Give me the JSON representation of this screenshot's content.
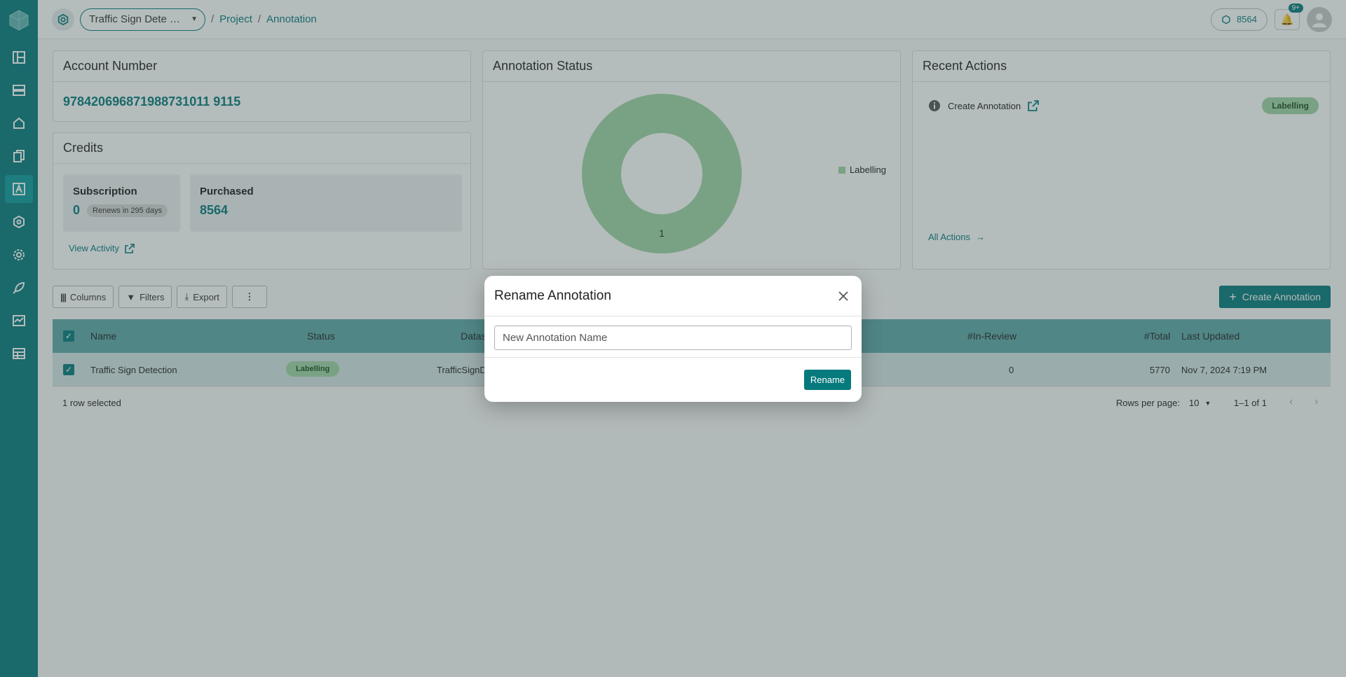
{
  "header": {
    "project_name": "Traffic Sign Dete …",
    "breadcrumb_sep": "/",
    "breadcrumb": [
      "Project",
      "Annotation"
    ],
    "credits_count": "8564",
    "notification_badge": "9+"
  },
  "account": {
    "title": "Account Number",
    "number": "978420696871988731011 9115"
  },
  "credits": {
    "title": "Credits",
    "subscription_label": "Subscription",
    "subscription_value": "0",
    "renew_text": "Renews in 295 days",
    "purchased_label": "Purchased",
    "purchased_value": "8564",
    "view_activity": "View Activity"
  },
  "annotation_status": {
    "title": "Annotation Status",
    "legend": "Labelling",
    "slice_value": "1"
  },
  "chart_data": {
    "type": "pie",
    "categories": [
      "Labelling"
    ],
    "values": [
      1
    ],
    "title": "Annotation Status",
    "legend_position": "right"
  },
  "recent_actions": {
    "title": "Recent Actions",
    "item_label": "Create Annotation",
    "item_status": "Labelling",
    "all_actions": "All Actions"
  },
  "toolbar": {
    "columns": "Columns",
    "filters": "Filters",
    "export": "Export",
    "create": "Create Annotation"
  },
  "table": {
    "headers": {
      "name": "Name",
      "status": "Status",
      "dataset": "Datase",
      "in_review": "#In-Review",
      "total": "#Total",
      "last_updated": "Last Updated"
    },
    "row": {
      "name": "Traffic Sign Detection",
      "status": "Labelling",
      "dataset": "TrafficSignD",
      "in_review": "0",
      "total": "5770",
      "last_updated": "Nov 7, 2024 7:19 PM"
    }
  },
  "footer": {
    "selected": "1 row selected",
    "rows_per_page_label": "Rows per page:",
    "rows_per_page": "10",
    "range": "1–1 of 1"
  },
  "modal": {
    "title": "Rename Annotation",
    "placeholder": "New Annotation Name",
    "submit": "Rename"
  },
  "colors": {
    "primary": "#067a7c",
    "labelling": "#9fd6a5"
  }
}
